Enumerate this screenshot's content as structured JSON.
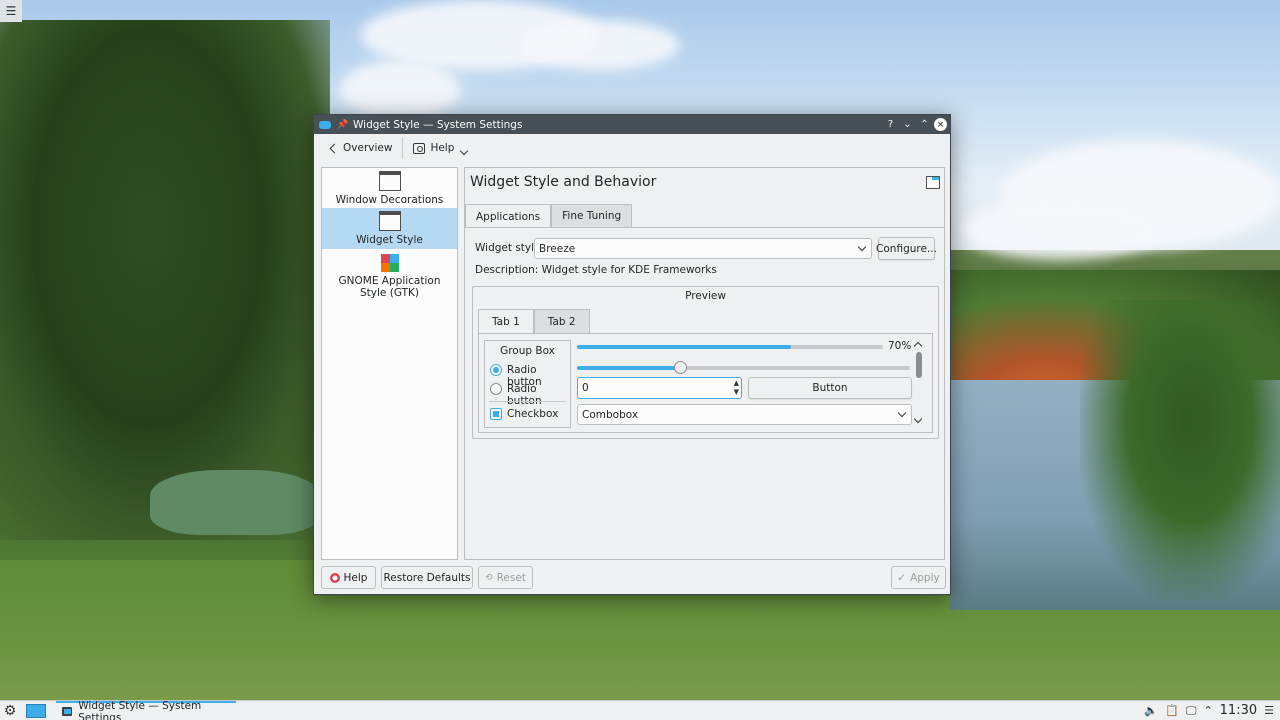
{
  "window": {
    "title": "Widget Style — System Settings",
    "controls": {
      "help": "?",
      "minimize": "⌄",
      "maximize": "⌃",
      "close": "×"
    }
  },
  "toolbar": {
    "overview_label": "Overview",
    "help_label": "Help"
  },
  "sidebar": {
    "items": [
      {
        "label": "Window Decorations",
        "icon": "window-decorations-icon",
        "selected": false
      },
      {
        "label": "Widget Style",
        "icon": "widget-style-icon",
        "selected": true
      },
      {
        "label": "GNOME Application Style (GTK)",
        "icon": "gtk-icon",
        "selected": false
      }
    ]
  },
  "main": {
    "title": "Widget Style and Behavior",
    "tabs": [
      {
        "label": "Applications",
        "active": true
      },
      {
        "label": "Fine Tuning",
        "active": false
      }
    ],
    "widget_style_label": "Widget style:",
    "widget_style_value": "Breeze",
    "configure_label": "Configure...",
    "description": "Description: Widget style for KDE Frameworks",
    "preview": {
      "title": "Preview",
      "tabs": [
        {
          "label": "Tab 1",
          "active": true
        },
        {
          "label": "Tab 2",
          "active": false
        }
      ],
      "group_box_title": "Group Box",
      "radio1_label": "Radio button",
      "radio2_label": "Radio button",
      "checkbox_label": "Checkbox",
      "progress_text": "70%",
      "progress_value": 0.7,
      "slider_value": 0.31,
      "spinbox_value": "0",
      "button_label": "Button",
      "combobox_value": "Combobox"
    }
  },
  "footer": {
    "help_label": "Help",
    "restore_label": "Restore Defaults",
    "reset_label": "Reset",
    "apply_label": "Apply"
  },
  "taskbar": {
    "task_label": "Widget Style — System Settings",
    "clock": "11:30"
  },
  "colors": {
    "accent": "#3daee9",
    "titlebar": "#475057",
    "window_bg": "#eff0f1",
    "selection": "#b5d9f2"
  }
}
